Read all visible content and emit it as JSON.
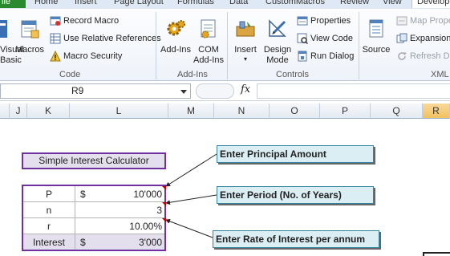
{
  "ribbon_tabs": {
    "file": "ile",
    "home": "Home",
    "insert": "Insert",
    "page_layout": "Page Layout",
    "formulas": "Formulas",
    "data": "Data",
    "custom_macros": "CustomMacros",
    "review": "Review",
    "view": "View",
    "developer": "Develope"
  },
  "ribbon": {
    "code": {
      "visual_basic_partial": "Visual\nBasic",
      "macros": "Macros",
      "record_macro": "Record Macro",
      "relative_refs": "Use Relative References",
      "macro_security": "Macro Security",
      "group_label": "Code"
    },
    "addins": {
      "addins": "Add-Ins",
      "com_addins": "COM\nAdd-Ins",
      "group_label": "Add-Ins"
    },
    "controls": {
      "insert": "Insert",
      "design_mode": "Design\nMode",
      "properties": "Properties",
      "view_code": "View Code",
      "run_dialog": "Run Dialog",
      "group_label": "Controls"
    },
    "xml": {
      "source": "Source",
      "map_properties": "Map Prope",
      "expansion": "Expansion",
      "refresh_data": "Refresh Da",
      "group_label": "XML"
    }
  },
  "formula_bar": {
    "name_box": "R9",
    "fx": "fx",
    "formula": ""
  },
  "columns": [
    "J",
    "K",
    "L",
    "M",
    "N",
    "O",
    "P",
    "Q",
    "R"
  ],
  "sheet": {
    "title": "Simple Interest Calculator",
    "rows": [
      {
        "label": "P",
        "currency": "$",
        "value": "10'000"
      },
      {
        "label": "n",
        "currency": "",
        "value": "3"
      },
      {
        "label": "r",
        "currency": "",
        "value": "10.00%"
      },
      {
        "label": "Interest",
        "currency": "$",
        "value": "3'000"
      }
    ]
  },
  "notes": {
    "principal": "Enter Principal Amount",
    "period": "Enter Period (No. of Years)",
    "rate": "Enter Rate of Interest per annum"
  },
  "colors": {
    "accent_border": "#7030a0",
    "fill": "#e4dfec",
    "note_fill": "#daeef3",
    "comment_marker": "#c00000"
  }
}
